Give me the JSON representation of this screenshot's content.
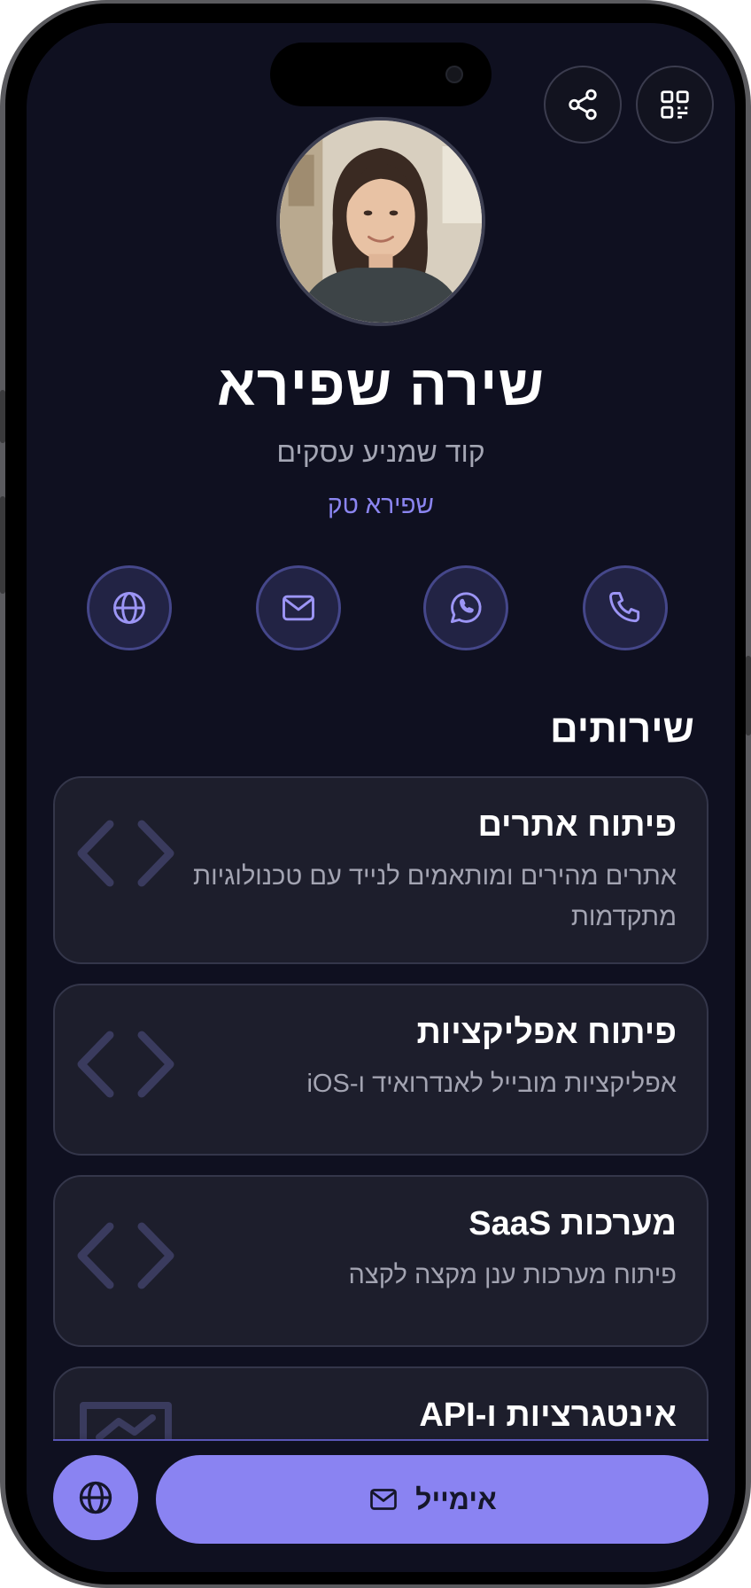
{
  "profile": {
    "name": "שירה שפירא",
    "title": "קוד שמניע עסקים",
    "company": "שפירא טק"
  },
  "top_actions": [
    {
      "icon": "qr-code-icon"
    },
    {
      "icon": "share-icon"
    }
  ],
  "contact_buttons": [
    {
      "icon": "phone-icon"
    },
    {
      "icon": "whatsapp-icon"
    },
    {
      "icon": "mail-icon"
    },
    {
      "icon": "globe-icon"
    }
  ],
  "services": {
    "title": "שירותים",
    "items": [
      {
        "title": "פיתוח אתרים",
        "description": "אתרים מהירים ומותאמים לנייד עם טכנולוגיות מתקדמות",
        "icon": "code-icon"
      },
      {
        "title": "פיתוח אפליקציות",
        "description": "אפליקציות מובייל לאנדרואיד ו-iOS",
        "icon": "code-icon"
      },
      {
        "title": "מערכות SaaS",
        "description": "פיתוח מערכות ענן מקצה לקצה",
        "icon": "code-icon"
      },
      {
        "title": "אינטגרציות ו-API",
        "description": "",
        "icon": "handshake-icon"
      }
    ]
  },
  "bottom_bar": {
    "email_label": "אימייל",
    "email_icon": "mail-icon",
    "website_icon": "globe-icon"
  },
  "colors": {
    "background": "#0f1020",
    "card": "#1d1e2c",
    "accent": "#8a83f2",
    "accent_text": "#8b85f0"
  }
}
